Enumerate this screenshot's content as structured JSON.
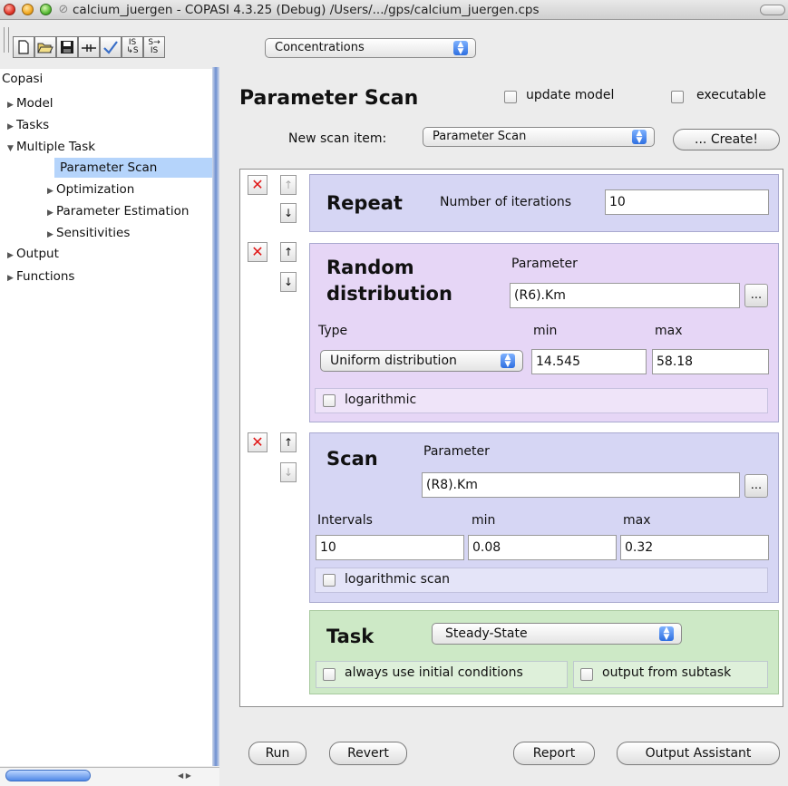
{
  "window": {
    "title": "calcium_juergen - COPASI 4.3.25 (Debug) /Users/.../gps/calcium_juergen.cps"
  },
  "toolbar": {
    "icons": [
      "new-document-icon",
      "open-folder-icon",
      "save-disk-icon",
      "slider-icon",
      "check-icon",
      "is-to-s-icon",
      "s-to-is-icon"
    ],
    "is_s_top": "IS",
    "is_s_bottom": "↳S",
    "s_is_top": "S→",
    "s_is_bottom": "IS",
    "units_combo": "Concentrations"
  },
  "tree": {
    "root": "Copasi",
    "items": [
      {
        "label": "Model",
        "expanded": false
      },
      {
        "label": "Tasks",
        "expanded": false
      },
      {
        "label": "Multiple Task",
        "expanded": true
      },
      {
        "label": "Parameter Scan",
        "selected": true
      },
      {
        "label": "Optimization",
        "expanded": false
      },
      {
        "label": "Parameter Estimation",
        "expanded": false
      },
      {
        "label": "Sensitivities",
        "expanded": false
      },
      {
        "label": "Output",
        "expanded": false
      },
      {
        "label": "Functions",
        "expanded": false
      }
    ]
  },
  "main": {
    "title": "Parameter Scan",
    "update_model_label": "update model",
    "executable_label": "executable",
    "new_scan_item_label": "New scan item:",
    "new_scan_item_value": "Parameter Scan",
    "create_label": "... Create!"
  },
  "repeat": {
    "title": "Repeat",
    "iterations_label": "Number of iterations",
    "iterations_value": "10"
  },
  "random": {
    "title_line1": "Random",
    "title_line2": "distribution",
    "parameter_label": "Parameter",
    "parameter_value": "(R6).Km",
    "type_label": "Type",
    "min_label": "min",
    "max_label": "max",
    "type_value": "Uniform distribution",
    "min_value": "14.545",
    "max_value": "58.18",
    "logarithmic_label": "logarithmic"
  },
  "scan": {
    "title": "Scan",
    "parameter_label": "Parameter",
    "parameter_value": "(R8).Km",
    "intervals_label": "Intervals",
    "min_label": "min",
    "max_label": "max",
    "intervals_value": "10",
    "min_value": "0.08",
    "max_value": "0.32",
    "logarithmic_label": "logarithmic scan"
  },
  "task": {
    "title": "Task",
    "task_value": "Steady-State",
    "initial_conditions_label": "always use initial conditions",
    "output_label": "output from subtask"
  },
  "buttons": {
    "run": "Run",
    "revert": "Revert",
    "report": "Report",
    "output_assistant": "Output Assistant"
  },
  "glyphs": {
    "delete": "✕",
    "up": "↑",
    "down": "↓",
    "dots": "...",
    "stepper_up": "▲",
    "stepper_down": "▼"
  }
}
